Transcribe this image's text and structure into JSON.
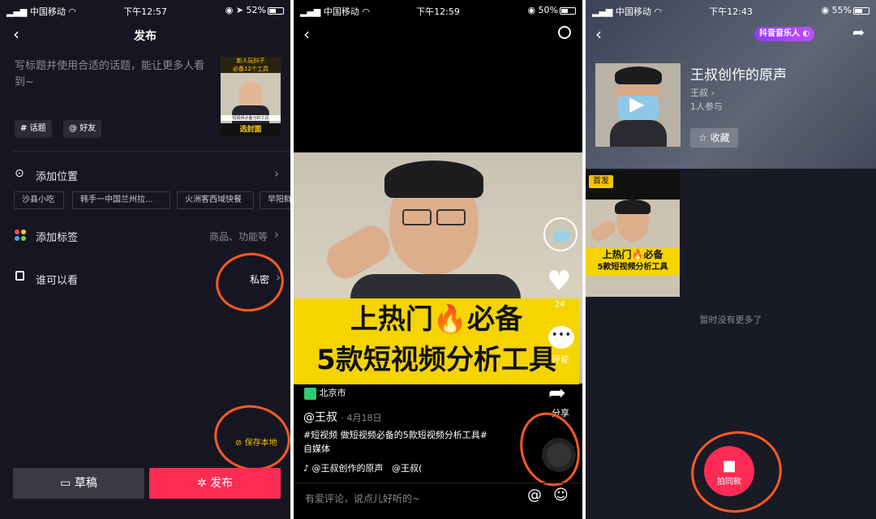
{
  "panel1": {
    "status": {
      "carrier": "中国移动",
      "time": "下午12:57",
      "battery": "52%",
      "battery_fill": 0.52
    },
    "header": {
      "back_icon": "chevron-left",
      "title": "发布"
    },
    "caption_placeholder": "写标题并使用合适的话题，能让更多人看到~",
    "cover": {
      "top_text_1": "新人玩抖子",
      "top_text_2": "必备12个工具",
      "sub_text": "短视频必备分析工具",
      "choose_cover": "选封面"
    },
    "tags": {
      "topic": "话题",
      "friend": "好友"
    },
    "location": {
      "label": "添加位置",
      "chips": [
        "沙县小吃",
        "韩手一中国兰州拉...",
        "火洲客西域快餐",
        "早阳鲜"
      ]
    },
    "label_row": {
      "label": "添加标签",
      "hint": "商品、功能等"
    },
    "privacy": {
      "label": "谁可以看",
      "value": "私密"
    },
    "save_local": "保存本地",
    "draft_button": "草稿",
    "publish_button": "发布"
  },
  "panel2": {
    "status": {
      "carrier": "中国移动",
      "time": "下午12:59",
      "battery": "50%",
      "battery_fill": 0.5
    },
    "video_title_1": "上热门🔥必备",
    "video_title_2": "5款短视频分析工具",
    "likes": "24",
    "comment_label": "评论",
    "share_label": "分享",
    "location": "北京市",
    "author": "@王叔",
    "date": "· 4月18日",
    "description_1": "#短视频 做短视频必备的5款短视频分析工具#",
    "description_2": "自媒体",
    "music": "@王叔创作的原声",
    "music_author": "@王叔(",
    "comment_placeholder": "有爱评论，说点儿好听的~"
  },
  "panel3": {
    "status": {
      "carrier": "中国移动",
      "time": "下午12:43",
      "battery": "55%",
      "battery_fill": 0.55
    },
    "brand": "抖音音乐人",
    "sound_title": "王叔创作的原声",
    "artist": "王叔",
    "participants": "1人参与",
    "favorite": "收藏",
    "first_badge": "首发",
    "thumb_line_1": "上热门🔥必备",
    "thumb_line_2": "5款短视频分析工具",
    "no_more": "暂时没有更多了",
    "shoot_same": "拍同款"
  }
}
